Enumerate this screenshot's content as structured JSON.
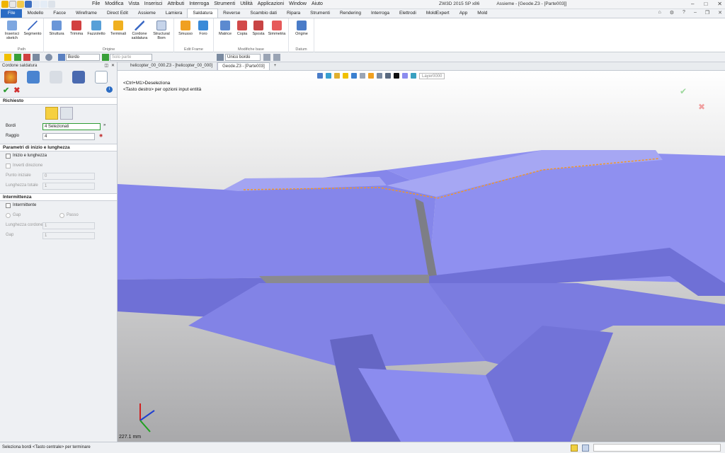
{
  "menubar": [
    "File",
    "Modifica",
    "Vista",
    "Inserisci",
    "Attributi",
    "Interroga",
    "Strumenti",
    "Utilità",
    "Applicazioni",
    "Window",
    "Aiuto"
  ],
  "window": {
    "app": "ZW3D 2015 SP x86",
    "doc": "Assieme - [Geode.Z3 - [Parte003]]"
  },
  "tabs": [
    "File",
    "Modello",
    "Facce",
    "Wireframe",
    "Direct Edit",
    "Assieme",
    "Lamiera",
    "Saldatura",
    "Reverse",
    "Scambio dati",
    "Ripara",
    "Strumenti",
    "Rendering",
    "Interroga",
    "Elettrodi",
    "MoldExpert",
    "App",
    "Mold"
  ],
  "active_tab": "Saldatura",
  "ribbon": {
    "groups": [
      {
        "label": "Path",
        "buttons": [
          "Inserisci sketch",
          "Segmento"
        ]
      },
      {
        "label": "Origine",
        "buttons": [
          "Struttura",
          "Trimma",
          "Fazzoletto",
          "Terminali",
          "Cordone saldatura",
          "Structural Bom"
        ]
      },
      {
        "label": "Edit Frame",
        "buttons": [
          "Smusso",
          "Foro"
        ]
      },
      {
        "label": "Modifiche base",
        "buttons": [
          "Matrice",
          "Copia",
          "Sposta",
          "Simmetria"
        ]
      },
      {
        "label": "Datum",
        "buttons": [
          "Origine"
        ]
      }
    ]
  },
  "toolbar": {
    "filter": "Bordo",
    "solo_parte": "Solo parte",
    "unico_bordo": "Unico bordo"
  },
  "panel": {
    "title": "Cordone saldatura",
    "richiesto": "Richiesto",
    "bordi_label": "Bordi",
    "bordi_value": "4 Selezionati",
    "raggio_label": "Raggio",
    "raggio_value": "4",
    "param_title": "Parametri di inizio e lunghezza",
    "inizio_lunghezza": "Inizio e lunghezza",
    "inverti": "Inverti direzione",
    "punto_iniziale": "Punto iniziale",
    "punto_val": "0",
    "lunghezza_totale": "Lunghezza totale",
    "lunghezza_val": "1",
    "intermittenza_title": "Intermittenza",
    "intermittente": "Intermittente",
    "gap_radio": "Gap",
    "passo_radio": "Passo",
    "lunghezza_cordone": "Lunghezza cordone",
    "cordone_val": "1",
    "gap_label": "Gap",
    "gap_val": "1"
  },
  "view_tabs": [
    "helicopter_00_000.Z3 - [helicopter_00_000]",
    "Geode.Z3 - [Parte003]"
  ],
  "layer": "Layer0000",
  "hints": [
    "<Ctrl+M1>Deseleziona",
    "<Tasto destro> per opzioni input entità"
  ],
  "scale": "227.1 mm",
  "status": "Seleziona bordi <Tasto centrale> per terminare",
  "colors": {
    "accent": "#2b6cc4",
    "part": "#8b8cef",
    "weld": "#f0962a"
  }
}
